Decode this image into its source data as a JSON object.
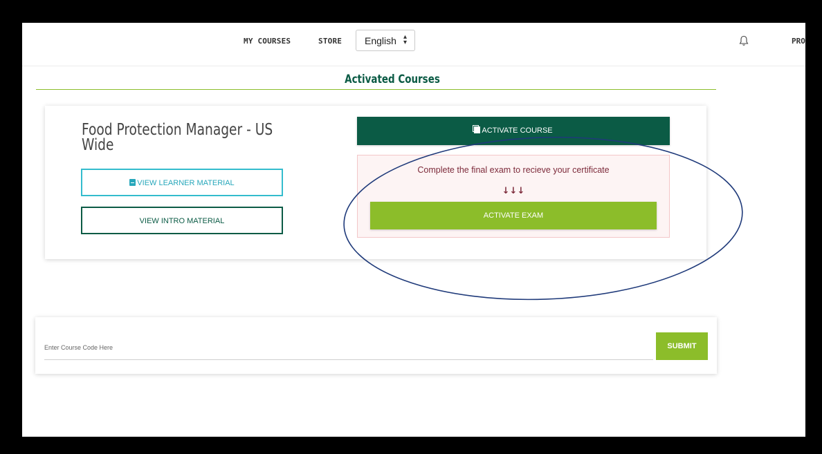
{
  "nav": {
    "my_courses": "MY COURSES",
    "store": "STORE",
    "language": "English",
    "profile": "PRO"
  },
  "page": {
    "title": "Activated Courses"
  },
  "course": {
    "title": "Food Protection Manager - US Wide",
    "view_learner_material": "VIEW LEARNER MATERIAL",
    "view_intro_material": "VIEW INTRO MATERIAL",
    "activate_course": "ACTIVATE COURSE",
    "exam_message": "Complete the final exam to recieve your certificate",
    "exam_arrows": "↓↓↓",
    "activate_exam": "ACTIVATE EXAM"
  },
  "code_form": {
    "placeholder": "Enter Course Code Here",
    "submit": "SUBMIT"
  },
  "icons": {
    "bell": "bell-icon",
    "learner": "book-icon",
    "activate": "copy-icon",
    "select_caret": "sort-caret-icon"
  },
  "colors": {
    "brand_dark_green": "#0b5b45",
    "accent_green": "#8cbd2a",
    "teal": "#33bccd",
    "alert_text": "#7d2b3b",
    "alert_bg": "#fdf4f4",
    "annotation": "#1f3a7a"
  }
}
